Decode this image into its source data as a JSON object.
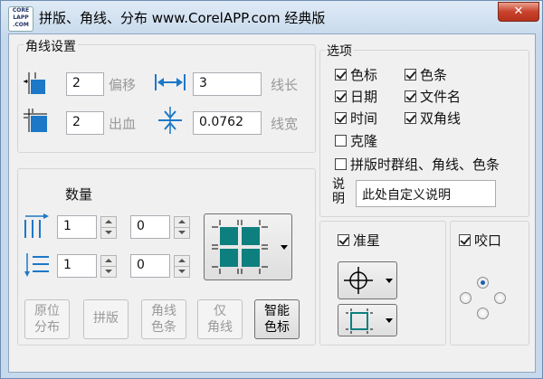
{
  "window": {
    "title": "拼版、角线、分布  www.CorelAPP.com 经典版",
    "logo_text": "CORE LAPP .COM",
    "close_glyph": "✕"
  },
  "corner_settings": {
    "title": "角线设置",
    "offset": {
      "value": "2",
      "label": "偏移"
    },
    "line_length": {
      "value": "3",
      "label": "线长"
    },
    "bleed": {
      "value": "2",
      "label": "出血"
    },
    "line_width": {
      "value": "0.0762",
      "label": "线宽"
    }
  },
  "options": {
    "title": "选项",
    "items": [
      {
        "label": "色标",
        "checked": true
      },
      {
        "label": "色条",
        "checked": true
      },
      {
        "label": "日期",
        "checked": true
      },
      {
        "label": "文件名",
        "checked": true
      },
      {
        "label": "时间",
        "checked": true
      },
      {
        "label": "双角线",
        "checked": true
      },
      {
        "label": "克隆",
        "checked": false
      },
      {
        "label": "拼版时群组、角线、色条",
        "checked": false
      }
    ],
    "note_label": "说明",
    "note_value": "此处自定义说明"
  },
  "quantity": {
    "title": "数量",
    "row1": {
      "a": "1",
      "b": "0"
    },
    "row2": {
      "a": "1",
      "b": "0"
    }
  },
  "buttons": {
    "original_distribute": "原位\n分布",
    "impose": "拼版",
    "corner_color_bar": "角线\n色条",
    "corner_only": "仅\n角线",
    "smart_color_mark": "智能\n色标"
  },
  "registration": {
    "label": "准星",
    "checked": true
  },
  "bite": {
    "label": "咬口",
    "checked": true,
    "selected_position": "top"
  },
  "colors": {
    "teal": "#0e7f7f",
    "accent_blue": "#1d78c8",
    "frame_blue": "#6e8db0"
  }
}
